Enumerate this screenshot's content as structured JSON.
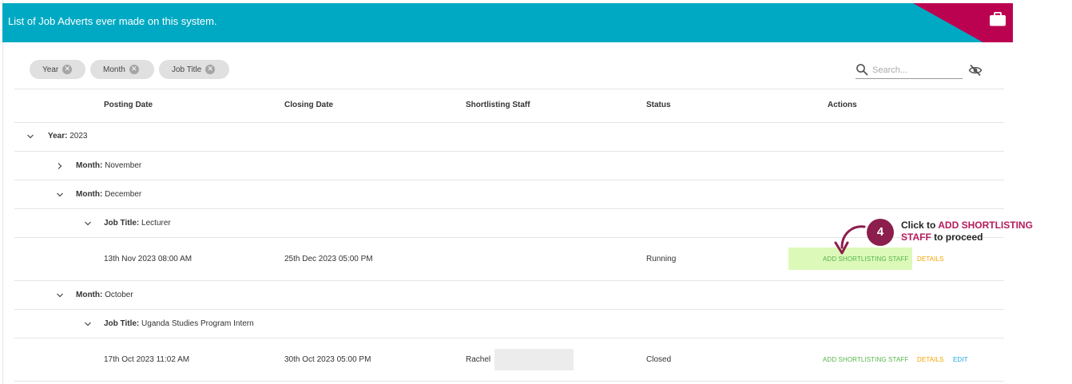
{
  "header": {
    "title": "List of Job Adverts ever made on this system.",
    "icon": "briefcase-icon",
    "colors": {
      "bar": "#00a9c3",
      "corner": "#bb0251"
    }
  },
  "filters": [
    {
      "label": "Year"
    },
    {
      "label": "Month"
    },
    {
      "label": "Job Title"
    }
  ],
  "search": {
    "placeholder": "Search..."
  },
  "columns": [
    "Posting Date",
    "Closing Date",
    "Shortlisting Staff",
    "Status",
    "Actions"
  ],
  "groups": {
    "year_label": "Year:",
    "year_value": "2023",
    "month_label": "Month:",
    "job_label": "Job Title:",
    "november": "November",
    "december": "December",
    "december_job": "Lecturer",
    "october": "October",
    "october_job": "Uganda Studies Program Intern"
  },
  "rows": [
    {
      "posting": "13th Nov 2023 08:00 AM",
      "closing": "25th Dec 2023 05:00 PM",
      "staff": "",
      "status": "Running",
      "actions": {
        "add": "ADD SHORTLISTING STAFF",
        "details": "DETAILS"
      }
    },
    {
      "posting": "17th Oct 2023 11:02 AM",
      "closing": "30th Oct 2023 05:00 PM",
      "staff": "Rachel",
      "status": "Closed",
      "actions": {
        "add": "ADD SHORTLISTING STAFF",
        "details": "DETAILS",
        "edit": "EDIT"
      }
    }
  ],
  "callout": {
    "step": "4",
    "line1_prefix": "Click  to ",
    "line1_accent": "ADD SHORTLISTING",
    "line2_accent": "STAFF",
    "line2_suffix": " to proceed"
  },
  "action_colors": {
    "add": "#56b54b",
    "details": "#f5a300",
    "edit": "#1da8e0"
  }
}
